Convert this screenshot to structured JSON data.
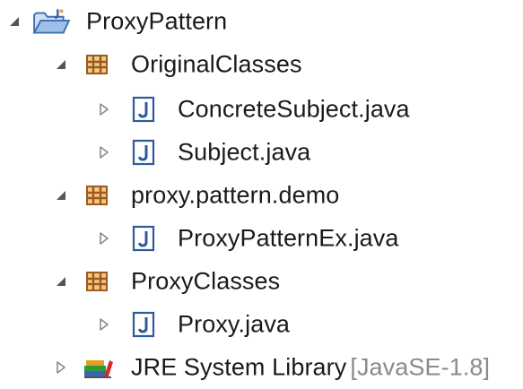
{
  "tree": {
    "project": {
      "label": "ProxyPattern",
      "icon": "java-project-icon",
      "expanded": true
    },
    "packages": [
      {
        "label": "OriginalClasses",
        "icon": "package-icon",
        "expanded": true,
        "files": [
          {
            "label": "ConcreteSubject.java",
            "icon": "java-file-icon"
          },
          {
            "label": "Subject.java",
            "icon": "java-file-icon"
          }
        ]
      },
      {
        "label": "proxy.pattern.demo",
        "icon": "package-icon",
        "expanded": true,
        "files": [
          {
            "label": "ProxyPatternEx.java",
            "icon": "java-file-icon"
          }
        ]
      },
      {
        "label": "ProxyClasses",
        "icon": "package-icon",
        "expanded": true,
        "files": [
          {
            "label": "Proxy.java",
            "icon": "java-file-icon"
          }
        ]
      }
    ],
    "library": {
      "label": "JRE System Library",
      "qualifier": "[JavaSE-1.8]",
      "icon": "library-icon",
      "expanded": false
    }
  },
  "colors": {
    "package_brown": "#9a5a22",
    "package_orange": "#e8a040",
    "java_blue": "#2f5a9a",
    "folder_blue": "#6f9fd8",
    "qualifier_gray": "#8a8a8a"
  }
}
